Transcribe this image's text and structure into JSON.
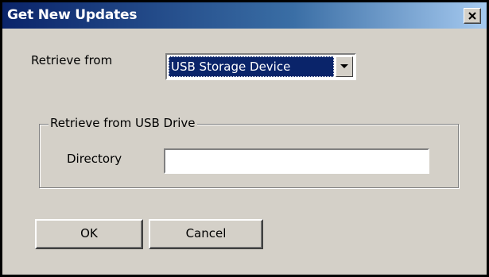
{
  "window": {
    "title": "Get New Updates",
    "close_glyph": "×"
  },
  "form": {
    "retrieve_label": "Retrieve from",
    "retrieve_value": "USB Storage Device",
    "retrieve_options": [
      "USB Storage Device"
    ],
    "group_label": "Retrieve from USB Drive",
    "directory_label": "Directory",
    "directory_value": "",
    "directory_placeholder": ""
  },
  "buttons": {
    "ok_label": "OK",
    "cancel_label": "Cancel"
  },
  "icons": {
    "close": "close-icon",
    "dropdown": "chevron-down-icon"
  },
  "colors": {
    "titlebar_start": "#0a246a",
    "titlebar_end": "#a6caf0",
    "dialog_face": "#d4d0c8",
    "selection": "#0a246a"
  }
}
